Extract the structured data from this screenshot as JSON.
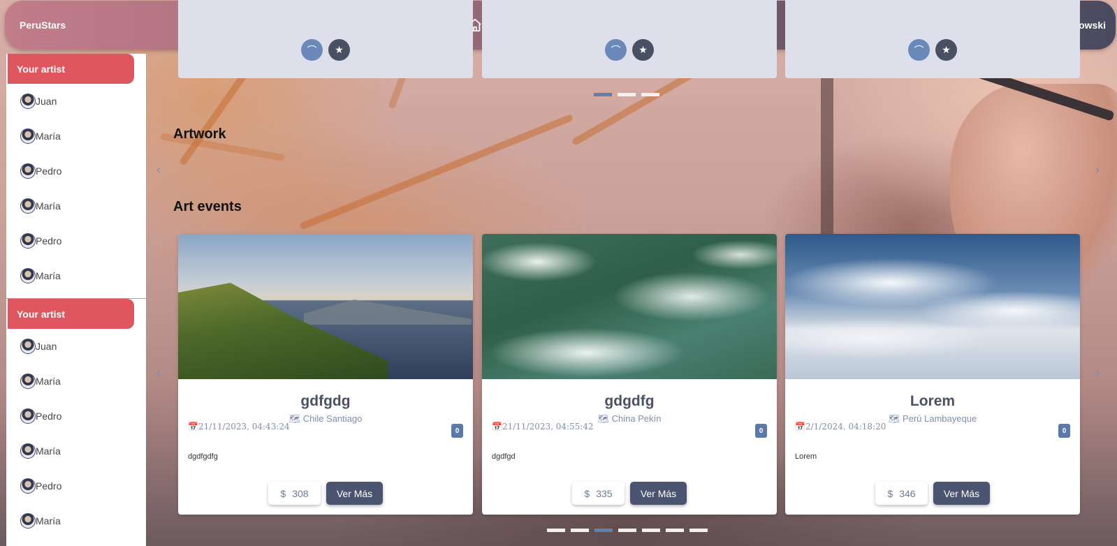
{
  "app": {
    "brand": "PeruStars"
  },
  "nav": {
    "icons": [
      "home-icon",
      "user-icon",
      "search-icon"
    ]
  },
  "user": {
    "name": "Robert Lewandowski"
  },
  "sidebar": [
    {
      "header": "Your artist",
      "items": [
        {
          "label": "Juan"
        },
        {
          "label": "María"
        },
        {
          "label": "Pedro"
        },
        {
          "label": "María"
        },
        {
          "label": "Pedro"
        },
        {
          "label": "María"
        }
      ]
    },
    {
      "header": "Your artist",
      "items": [
        {
          "label": "Juan"
        },
        {
          "label": "María"
        },
        {
          "label": "Pedro"
        },
        {
          "label": "María"
        },
        {
          "label": "Pedro"
        },
        {
          "label": "María"
        }
      ]
    }
  ],
  "sections": {
    "artwork": "Artwork",
    "art_events": "Art events"
  },
  "events": [
    {
      "title": "gdfgdg",
      "location": "Chile Santiago",
      "date": "21/11/2023,  04:43:24",
      "badge": "0",
      "description": "dgdfgdfg",
      "price": "308",
      "button": "Ver Más",
      "image": "coast"
    },
    {
      "title": "gdgdfg",
      "location": "China Pekín",
      "date": "21/11/2023,  04:55:42",
      "badge": "0",
      "description": "dgdfgd",
      "price": "335",
      "button": "Ver Más",
      "image": "sea"
    },
    {
      "title": "Lorem",
      "location": "Perú Lambayeque",
      "date": "2/1/2024,  04:18:20",
      "badge": "0",
      "description": "Lorem",
      "price": "346",
      "button": "Ver Más",
      "image": "sky"
    }
  ],
  "carousels": {
    "top_active_index": 0,
    "top_count": 3,
    "events_active_index": 2,
    "events_count": 7
  },
  "colors": {
    "accent_red": "#e0565f",
    "button_dark": "#4a5470",
    "link_blue": "#7f8eb0"
  }
}
